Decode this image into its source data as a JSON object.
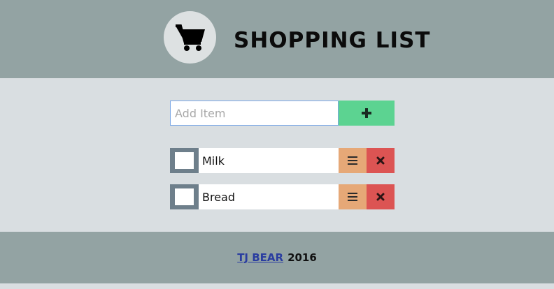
{
  "header": {
    "title": "SHOPPING LIST",
    "logo_icon": "shopping-cart-icon"
  },
  "add_form": {
    "placeholder": "Add Item",
    "value": "",
    "add_icon": "plus-icon"
  },
  "items": [
    {
      "label": "Milk",
      "checked": false
    },
    {
      "label": "Bread",
      "checked": false
    }
  ],
  "footer": {
    "author": "TJ BEAR",
    "year": "2016"
  },
  "colors": {
    "header_bg": "#93a3a3",
    "add_button": "#5cd391",
    "edit_button": "#e6a877",
    "delete_button": "#dc5453",
    "checkbox_frame": "#6e7f8b"
  }
}
